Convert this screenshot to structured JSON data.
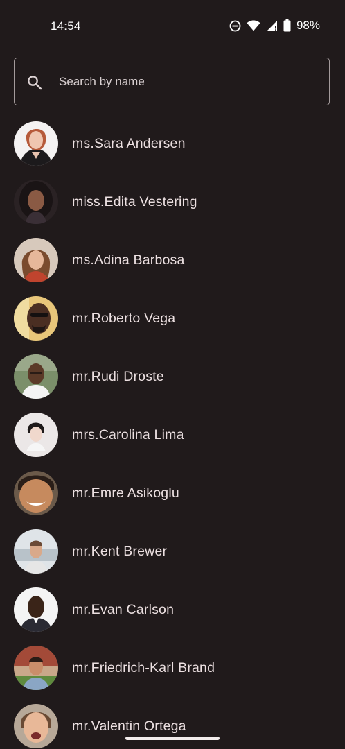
{
  "status_bar": {
    "time": "14:54",
    "battery_percent": "98%",
    "icons": [
      "do-not-disturb-icon",
      "wifi-icon",
      "signal-icon",
      "battery-icon"
    ]
  },
  "search": {
    "placeholder": "Search by name",
    "value": ""
  },
  "contacts": [
    {
      "name": "ms.Sara Andersen",
      "avatar": "avatar-photo"
    },
    {
      "name": "miss.Edita Vestering",
      "avatar": "avatar-photo"
    },
    {
      "name": "ms.Adina Barbosa",
      "avatar": "avatar-photo"
    },
    {
      "name": "mr.Roberto Vega",
      "avatar": "avatar-photo"
    },
    {
      "name": "mr.Rudi Droste",
      "avatar": "avatar-photo"
    },
    {
      "name": "mrs.Carolina Lima",
      "avatar": "avatar-photo"
    },
    {
      "name": "mr.Emre Asikoglu",
      "avatar": "avatar-photo"
    },
    {
      "name": "mr.Kent Brewer",
      "avatar": "avatar-photo"
    },
    {
      "name": "mr.Evan Carlson",
      "avatar": "avatar-photo"
    },
    {
      "name": "mr.Friedrich-Karl Brand",
      "avatar": "avatar-photo"
    },
    {
      "name": "mr.Valentin Ortega",
      "avatar": "avatar-photo"
    }
  ],
  "colors": {
    "background": "#201a1b",
    "text": "#ece0e1",
    "outline": "#a39a9b"
  }
}
